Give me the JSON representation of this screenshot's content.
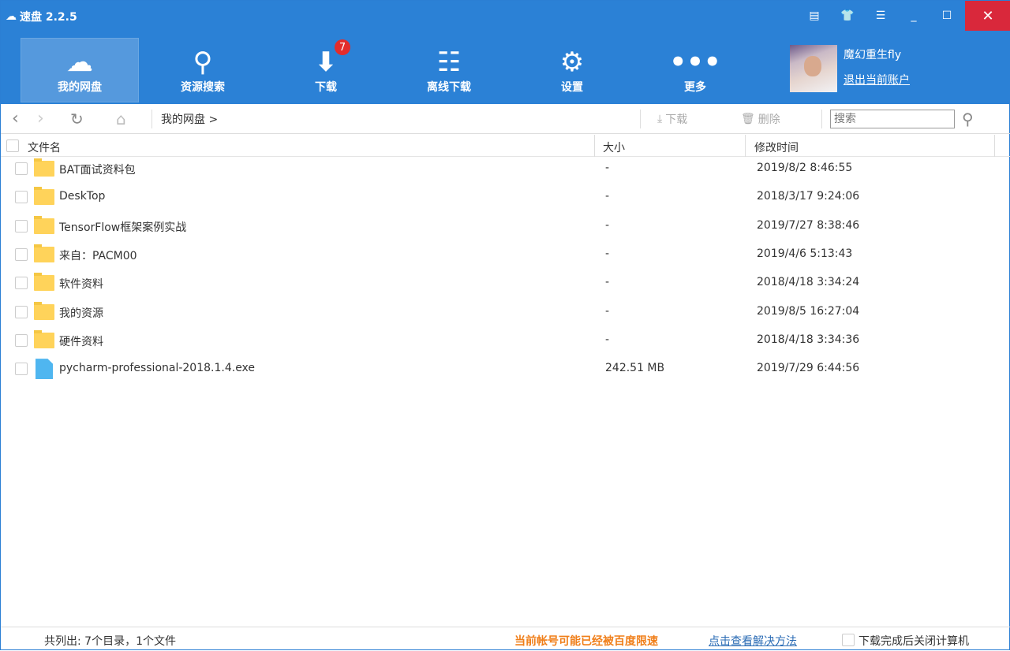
{
  "app": {
    "title": "速盘 2.2.5"
  },
  "nav": [
    {
      "label": "我的网盘",
      "icon": "cloud-icon"
    },
    {
      "label": "资源搜索",
      "icon": "search-icon"
    },
    {
      "label": "下载",
      "icon": "download-icon",
      "badge": "7"
    },
    {
      "label": "离线下载",
      "icon": "list-icon"
    },
    {
      "label": "设置",
      "icon": "gear-icon"
    },
    {
      "label": "更多",
      "icon": "more-icon"
    }
  ],
  "user": {
    "name": "魔幻重生fly",
    "logout": "退出当前账户"
  },
  "toolbar": {
    "breadcrumb": "我的网盘 >",
    "download": "下载",
    "delete": "删除",
    "search_placeholder": "搜索"
  },
  "columns": {
    "name": "文件名",
    "size": "大小",
    "mtime": "修改时间"
  },
  "files": [
    {
      "name": "BAT面试资料包",
      "size": "-",
      "mtime": "2019/8/2 8:46:55",
      "type": "folder"
    },
    {
      "name": "DeskTop",
      "size": "-",
      "mtime": "2018/3/17 9:24:06",
      "type": "folder"
    },
    {
      "name": "TensorFlow框架案例实战",
      "size": "-",
      "mtime": "2019/7/27 8:38:46",
      "type": "folder"
    },
    {
      "name": "来自：PACM00",
      "size": "-",
      "mtime": "2019/4/6 5:13:43",
      "type": "folder"
    },
    {
      "name": "软件资料",
      "size": "-",
      "mtime": "2018/4/18 3:34:24",
      "type": "folder"
    },
    {
      "name": "我的资源",
      "size": "-",
      "mtime": "2019/8/5 16:27:04",
      "type": "folder"
    },
    {
      "name": "硬件资料",
      "size": "-",
      "mtime": "2018/4/18 3:34:36",
      "type": "folder"
    },
    {
      "name": "pycharm-professional-2018.1.4.exe",
      "size": "242.51 MB",
      "mtime": "2019/7/29 6:44:56",
      "type": "exe"
    }
  ],
  "status": {
    "summary": "共列出: 7个目录，1个文件",
    "warning": "当前帐号可能已经被百度限速",
    "solution": "点击查看解决方法",
    "shutdown": "下载完成后关闭计算机"
  },
  "colors": {
    "brand": "#2b81d6",
    "close": "#d9283b",
    "warning": "#f07f1a",
    "badge": "#e32c2c"
  }
}
